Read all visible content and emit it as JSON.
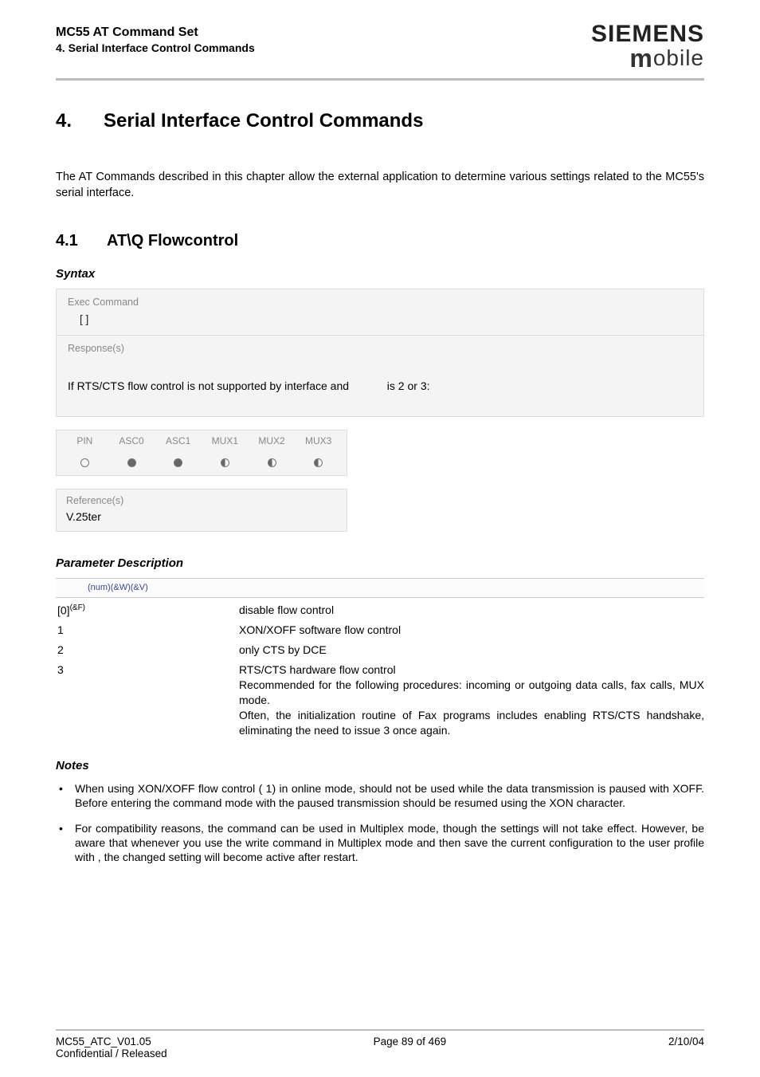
{
  "header": {
    "doc_title": "MC55 AT Command Set",
    "section_subtitle": "4. Serial Interface Control Commands",
    "brand": "SIEMENS",
    "brand_sub": "obile",
    "brand_sub_m": "m"
  },
  "section": {
    "num": "4.",
    "title": "Serial Interface Control Commands"
  },
  "intro": "The AT Commands described in this chapter allow the external application to determine various settings related to the MC55's serial interface.",
  "subsection": {
    "num": "4.1",
    "title": "AT\\Q   Flowcontrol"
  },
  "syntax_label": "Syntax",
  "exec": {
    "label": "Exec Command",
    "cmd": "[    ]"
  },
  "response": {
    "label": "Response(s)",
    "text_a": "If RTS/CTS flow control is not supported by interface and ",
    "text_b": " is 2 or 3:"
  },
  "pin": {
    "cols": [
      "PIN",
      "ASC0",
      "ASC1",
      "MUX1",
      "MUX2",
      "MUX3"
    ],
    "icons": [
      "empty",
      "full",
      "full",
      "half",
      "half",
      "half"
    ]
  },
  "reference": {
    "label": "Reference(s)",
    "value": "V.25ter"
  },
  "param_desc_label": "Parameter Description",
  "param_head": "(num)(&W)(&V)",
  "params": [
    {
      "key": "[0]",
      "sup": "(&F)",
      "val": "disable flow control"
    },
    {
      "key": "1",
      "sup": "",
      "val": "XON/XOFF software flow control"
    },
    {
      "key": "2",
      "sup": "",
      "val": "only CTS by DCE"
    },
    {
      "key": "3",
      "sup": "",
      "val": "RTS/CTS hardware flow control\nRecommended for the following procedures: incoming or outgoing data calls, fax calls, MUX mode.\nOften, the initialization routine of Fax programs includes enabling RTS/CTS handshake, eliminating the need to issue       3 once again."
    }
  ],
  "notes_label": "Notes",
  "notes": [
    "When using XON/XOFF flow control (        1) in online mode,          should not be used while the data transmission is paused with XOFF. Before entering the command mode with          the paused transmission should be resumed using the XON character.",
    "For compatibility reasons, the           command can be used in Multiplex mode, though the settings will not take effect. However, be aware that whenever you use the           write command in Multiplex mode and then save the current configuration to the user profile with          , the changed           setting will become active after restart."
  ],
  "footer": {
    "left": "MC55_ATC_V01.05",
    "center": "Page 89 of 469",
    "right": "2/10/04",
    "left2": "Confidential / Released"
  }
}
